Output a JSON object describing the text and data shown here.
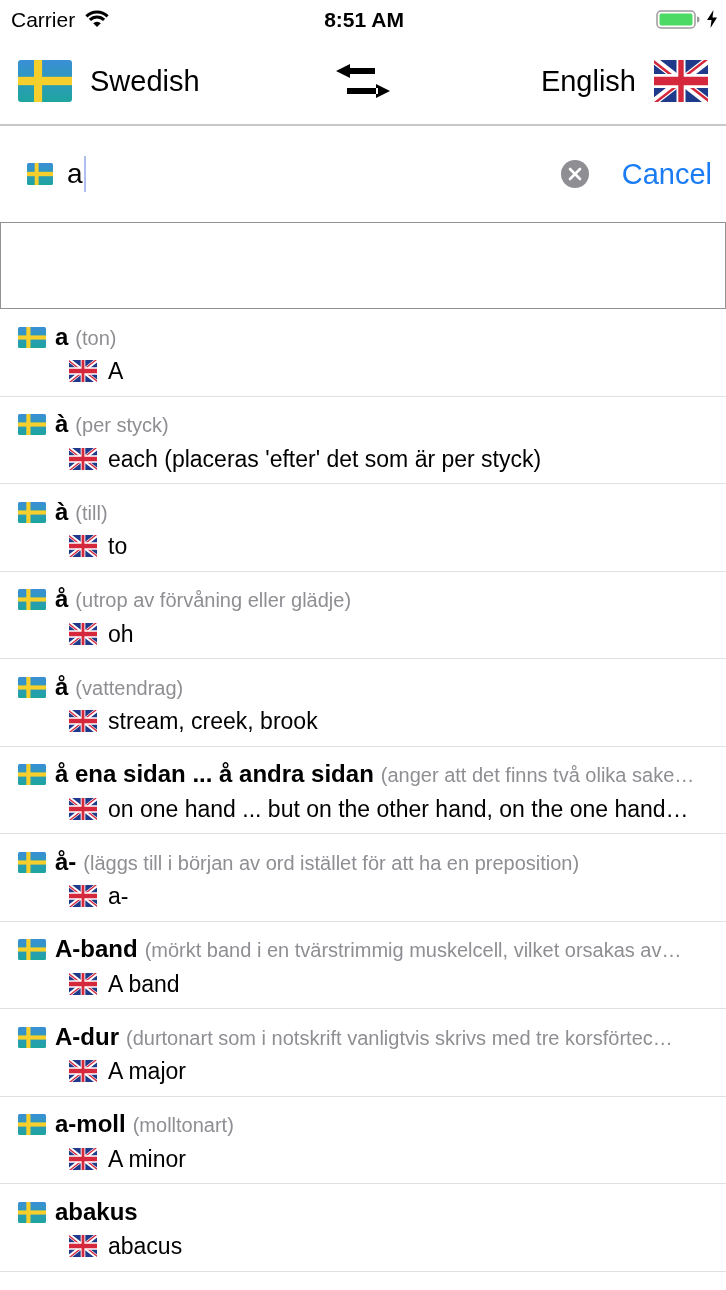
{
  "status_bar": {
    "carrier": "Carrier",
    "time": "8:51 AM"
  },
  "language_bar": {
    "source_language": "Swedish",
    "target_language": "English"
  },
  "search": {
    "value": "a",
    "cancel": "Cancel"
  },
  "results": [
    {
      "headword": "a",
      "gloss": "(ton)",
      "translation": "A"
    },
    {
      "headword": "à",
      "gloss": "(per styck)",
      "translation": "each (placeras 'efter' det som är per styck)"
    },
    {
      "headword": "à",
      "gloss": "(till)",
      "translation": "to"
    },
    {
      "headword": "å",
      "gloss": "(utrop av förvåning eller glädje)",
      "translation": "oh"
    },
    {
      "headword": "å",
      "gloss": "(vattendrag)",
      "translation": "stream, creek, brook"
    },
    {
      "headword": "å ena sidan ... å andra sidan",
      "gloss": "(anger att det finns två olika sake…",
      "translation": "on one hand ... but on the other hand, on the one hand…"
    },
    {
      "headword": "å-",
      "gloss": "(läggs till i början av ord istället för att ha en preposition)",
      "translation": "a-"
    },
    {
      "headword": "A-band",
      "gloss": "(mörkt band i en tvärstrimmig muskelcell, vilket orsakas av…",
      "translation": "A band"
    },
    {
      "headword": "A-dur",
      "gloss": "(durtonart som i notskrift vanligtvis skrivs med tre korsförtec…",
      "translation": "A major"
    },
    {
      "headword": "a-moll",
      "gloss": "(molltonart)",
      "translation": "A minor"
    },
    {
      "headword": "abakus",
      "translation": "abacus"
    }
  ]
}
